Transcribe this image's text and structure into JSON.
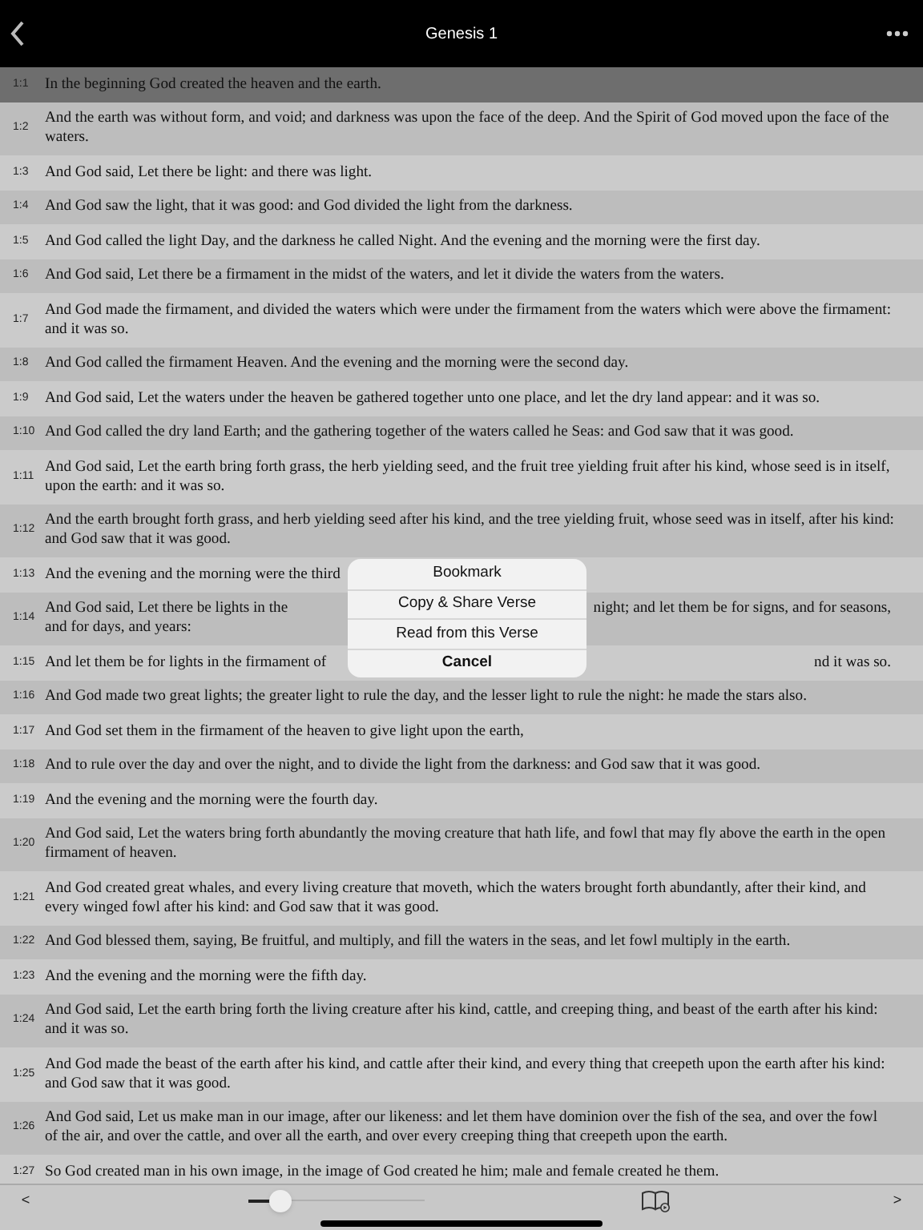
{
  "nav": {
    "title": "Genesis 1"
  },
  "verses": [
    {
      "ref": "1:1",
      "text": "In the beginning God created the heaven and the earth.",
      "selected": true
    },
    {
      "ref": "1:2",
      "text": "And the earth was without form, and void; and darkness was upon the face of the deep. And the Spirit of God moved upon the face of the waters.",
      "selected": false
    },
    {
      "ref": "1:3",
      "text": "And God said, Let there be light: and there was light.",
      "selected": false
    },
    {
      "ref": "1:4",
      "text": "And God saw the light, that it was good: and God divided the light from the darkness.",
      "selected": false
    },
    {
      "ref": "1:5",
      "text": "And God called the light Day, and the darkness he called Night. And the evening and the morning were the first day.",
      "selected": false
    },
    {
      "ref": "1:6",
      "text": "And God said, Let there be a firmament in the midst of the waters, and let it divide the waters from the waters.",
      "selected": false
    },
    {
      "ref": "1:7",
      "text": "And God made the firmament, and divided the waters which were under the firmament from the waters which were above the firmament: and it was so.",
      "selected": false
    },
    {
      "ref": "1:8",
      "text": "And God called the firmament Heaven. And the evening and the morning were the second day.",
      "selected": false
    },
    {
      "ref": "1:9",
      "text": "And God said, Let the waters under the heaven be gathered together unto one place, and let the dry land appear: and it was so.",
      "selected": false
    },
    {
      "ref": "1:10",
      "text": "And God called the dry land Earth; and the gathering together of the waters called he Seas: and God saw that it was good.",
      "selected": false
    },
    {
      "ref": "1:11",
      "text": "And God said, Let the earth bring forth grass, the herb yielding seed, and the fruit tree yielding fruit after his kind, whose seed is in itself, upon the earth: and it was so.",
      "selected": false
    },
    {
      "ref": "1:12",
      "text": "And the earth brought forth grass, and herb yielding seed after his kind, and the tree yielding fruit, whose seed was in itself, after his kind:",
      "more": "and God saw that it was good.",
      "selected": false
    },
    {
      "ref": "1:13",
      "text": "And the evening and the morning were the third",
      "selected": false
    },
    {
      "ref": "1:14",
      "text": "And God said, Let there be lights in the",
      "after": "night; and let them be for signs, and for seasons,",
      "more": "and for days, and years:",
      "selected": false
    },
    {
      "ref": "1:15",
      "text": "And let them be for lights in the firmament of",
      "after": "nd it was so.",
      "selected": false
    },
    {
      "ref": "1:16",
      "text": "And God made two great lights; the greater light to rule the day, and the lesser light to rule the night: he made the stars also.",
      "selected": false
    },
    {
      "ref": "1:17",
      "text": "And God set them in the firmament of the heaven to give light upon the earth,",
      "selected": false
    },
    {
      "ref": "1:18",
      "text": "And to rule over the day and over the night, and to divide the light from the darkness: and God saw that it was good.",
      "selected": false
    },
    {
      "ref": "1:19",
      "text": "And the evening and the morning were the fourth day.",
      "selected": false
    },
    {
      "ref": "1:20",
      "text": "And God said, Let the waters bring forth abundantly the moving creature that hath life, and fowl that may fly above the earth in the open firmament of heaven.",
      "selected": false
    },
    {
      "ref": "1:21",
      "text": "And God created great whales, and every living creature that moveth, which the waters brought forth abundantly, after their kind, and every winged fowl after his kind: and God saw that it was good.",
      "selected": false
    },
    {
      "ref": "1:22",
      "text": "And God blessed them, saying, Be fruitful, and multiply, and fill the waters in the seas, and let fowl multiply in the earth.",
      "selected": false
    },
    {
      "ref": "1:23",
      "text": "And the evening and the morning were the fifth day.",
      "selected": false
    },
    {
      "ref": "1:24",
      "text": "And God said, Let the earth bring forth the living creature after his kind, cattle, and creeping thing, and beast of the earth after his kind: and it was so.",
      "selected": false
    },
    {
      "ref": "1:25",
      "text": "And God made the beast of the earth after his kind, and cattle after their kind, and every thing that creepeth upon the earth after his kind: and God saw that it was good.",
      "selected": false
    },
    {
      "ref": "1:26",
      "text": "And God said, Let us make man in our image, after our likeness: and let them have dominion over the fish of the sea, and over the fowl of the air, and over the cattle, and over all the earth, and over every creeping thing that creepeth upon the earth.",
      "selected": false
    },
    {
      "ref": "1:27",
      "text": "So God created man in his own image, in the image of God created he him; male and female created he them.",
      "selected": false
    }
  ],
  "menu": [
    {
      "label": "Bookmark",
      "kind": "action"
    },
    {
      "label": "Copy & Share Verse",
      "kind": "action"
    },
    {
      "label": "Read from this Verse",
      "kind": "action"
    },
    {
      "label": "Cancel",
      "kind": "cancel"
    }
  ],
  "toolbar": {
    "prev": "<",
    "slider": {
      "level": 0.18
    },
    "next": ">"
  }
}
